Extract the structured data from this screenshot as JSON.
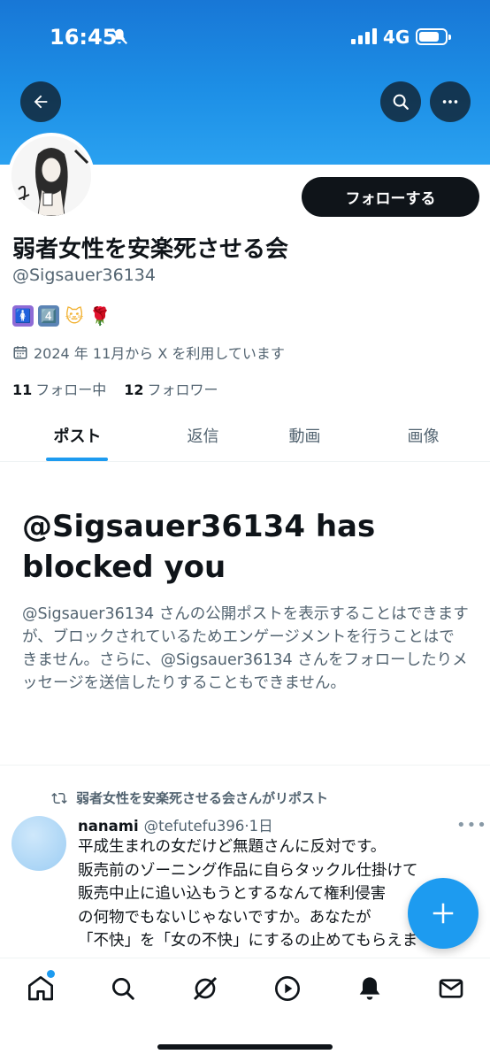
{
  "status_bar": {
    "time": "16:45",
    "network": "4G"
  },
  "header": {
    "back_icon": "arrow-left-icon",
    "search_icon": "search-icon",
    "more_icon": "more-horizontal-icon"
  },
  "profile": {
    "display_name": "弱者女性を安楽死させる会",
    "handle": "@Sigsauer36134",
    "follow_label": "フォローする",
    "bio_emojis": [
      "🚺",
      "4️⃣",
      "🐱",
      "🌹"
    ],
    "joined": "2024 年 11月から X を利用しています",
    "following_count": "11",
    "following_label": "フォロー中",
    "followers_count": "12",
    "followers_label": "フォロワー"
  },
  "tabs": [
    "ポスト",
    "返信",
    "動画",
    "画像"
  ],
  "blocked": {
    "title": "@Sigsauer36134 has blocked you",
    "message": "@Sigsauer36134 さんの公開ポストを表示することはできますが、ブロックされているためエンゲージメントを行うことはできません。さらに、@Sigsauer36134 さんをフォローしたりメッセージを送信したりすることもできません。"
  },
  "tweet": {
    "repost_label": "弱者女性を安楽死させる会さんがリポスト",
    "name": "nanami",
    "handle": "@tefutefu396",
    "time": "·1日",
    "lines": [
      "平成生まれの女だけど無題さんに反対です。",
      "販売前のゾーニング作品に自らタックル仕掛けて",
      "販売中止に追い込もうとするなんて権利侵害",
      "の何物でもないじゃないですか。あなたが",
      "「不快」を「女の不快」にするの止めてもらえま"
    ]
  },
  "colors": {
    "accent": "#1d9bf0",
    "text_primary": "#0f1419",
    "text_secondary": "#536471",
    "banner": "#1d8fe6"
  }
}
